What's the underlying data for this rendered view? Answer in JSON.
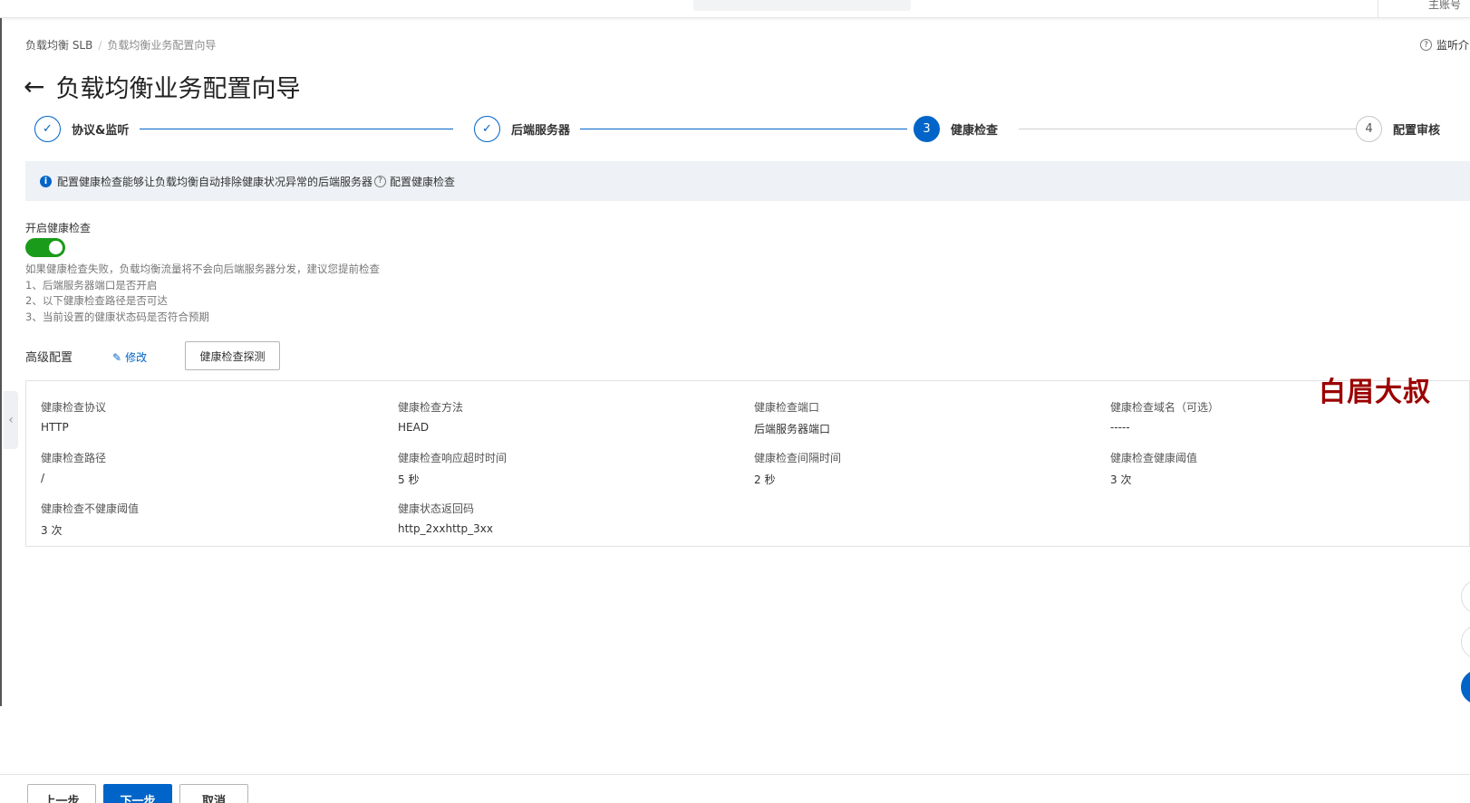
{
  "breadcrumb": {
    "root": "负载均衡 SLB",
    "current": "负载均衡业务配置向导"
  },
  "help": {
    "label": "监听介"
  },
  "header": {
    "title": "负载均衡业务配置向导"
  },
  "steps": [
    {
      "index": "1",
      "label": "协议&监听",
      "state": "done"
    },
    {
      "index": "2",
      "label": "后端服务器",
      "state": "done"
    },
    {
      "index": "3",
      "label": "健康检查",
      "state": "active"
    },
    {
      "index": "4",
      "label": "配置审核",
      "state": "todo"
    }
  ],
  "banner": {
    "text": "配置健康检查能够让负载均衡自动排除健康状况异常的后端服务器",
    "link": "配置健康检查"
  },
  "health_check": {
    "toggle_label": "开启健康检查",
    "enabled": true,
    "hints": [
      "如果健康检查失败，负载均衡流量将不会向后端服务器分发，建议您提前检查",
      "1、后端服务器端口是否开启",
      "2、以下健康检查路径是否可达",
      "3、当前设置的健康状态码是否符合预期"
    ]
  },
  "advanced": {
    "title": "高级配置",
    "edit_label": "修改",
    "probe_label": "健康检查探测",
    "items": [
      {
        "key": "健康检查协议",
        "value": "HTTP"
      },
      {
        "key": "健康检查方法",
        "value": "HEAD"
      },
      {
        "key": "健康检查端口",
        "value": "后端服务器端口"
      },
      {
        "key": "健康检查域名（可选）",
        "value": "-----"
      },
      {
        "key": "健康检查路径",
        "value": "/"
      },
      {
        "key": "健康检查响应超时时间",
        "value": "5 秒"
      },
      {
        "key": "健康检查间隔时间",
        "value": "2 秒"
      },
      {
        "key": "健康检查健康阈值",
        "value": "3 次"
      },
      {
        "key": "健康检查不健康阈值",
        "value": "3 次"
      },
      {
        "key": "健康状态返回码",
        "value": "http_2xxhttp_3xx"
      }
    ]
  },
  "watermark": "白眉大叔",
  "footer": {
    "prev": "上一步",
    "next": "下一步",
    "cancel": "取消"
  },
  "topbar": {
    "account": "主账号"
  },
  "colors": {
    "primary": "#0064c8",
    "toggle_on": "#1a9b1a",
    "watermark": "#9b0000"
  }
}
